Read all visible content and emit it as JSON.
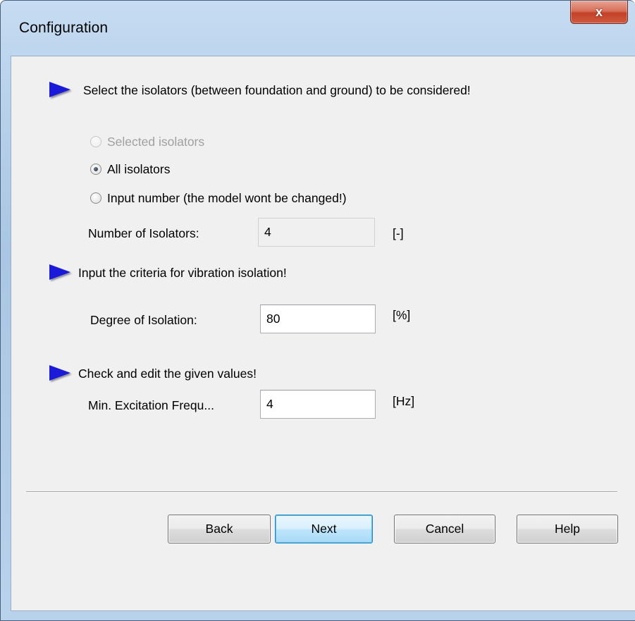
{
  "window": {
    "title": "Configuration",
    "close_label": "x"
  },
  "section_isolators": {
    "heading": "Select the isolators (between foundation and ground) to be considered!",
    "options": [
      {
        "label": "Selected isolators",
        "selected": false,
        "enabled": false
      },
      {
        "label": "All isolators",
        "selected": true,
        "enabled": true
      },
      {
        "label": "Input number (the model wont be changed!)",
        "selected": false,
        "enabled": true
      }
    ],
    "number_label": "Number of Isolators:",
    "number_value": "4",
    "number_unit": "[-]"
  },
  "section_criteria": {
    "heading": "Input the criteria for vibration isolation!",
    "degree_label": "Degree of Isolation:",
    "degree_value": "80",
    "degree_unit": "[%]"
  },
  "section_values": {
    "heading": "Check and edit the given values!",
    "freq_label": "Min. Excitation Frequ...",
    "freq_value": "4",
    "freq_unit": "[Hz]"
  },
  "buttons": {
    "back": "Back",
    "next": "Next",
    "cancel": "Cancel",
    "help": "Help"
  },
  "colors": {
    "arrow": "#1a1ad8",
    "client_bg": "#f0f0f0",
    "default_button_border": "#3c7fb1"
  }
}
